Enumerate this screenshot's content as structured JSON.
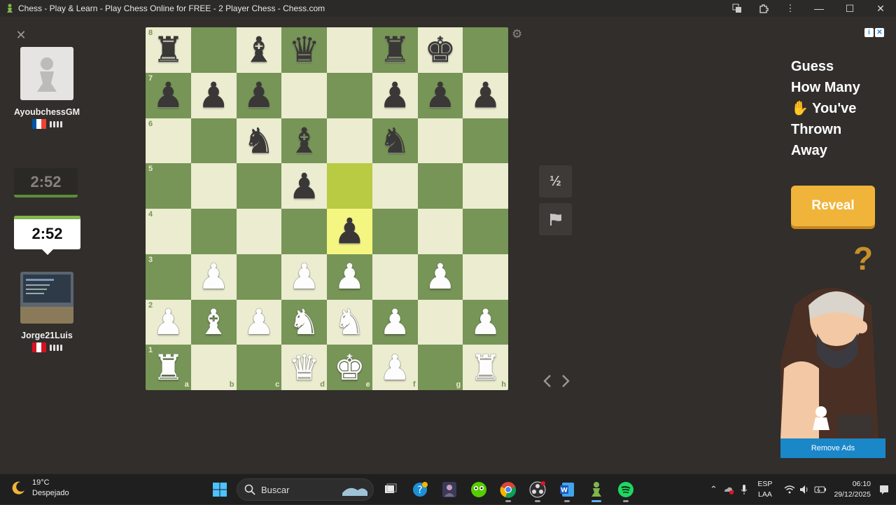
{
  "window": {
    "title": "Chess - Play & Learn - Play Chess Online for FREE - 2 Player Chess - Chess.com",
    "controls": {
      "minimize": "—",
      "maximize": "☐",
      "close": "✕"
    }
  },
  "players": {
    "opponent": {
      "name": "AyoubchessGM",
      "clock": "2:52",
      "country_colors": [
        "#0055a4",
        "#ffffff",
        "#ef4135"
      ]
    },
    "self": {
      "name": "Jorge21Luis",
      "clock": "2:52",
      "country_colors": [
        "#d91023",
        "#ffffff",
        "#d91023"
      ]
    }
  },
  "board": {
    "rank_labels": [
      "8",
      "7",
      "6",
      "5",
      "4",
      "3",
      "2",
      "1"
    ],
    "file_labels": [
      "a",
      "b",
      "c",
      "d",
      "e",
      "f",
      "g",
      "h"
    ],
    "highlighted_squares": [
      "e5",
      "e4"
    ],
    "position": [
      [
        "br",
        "",
        "bb",
        "bq",
        "",
        "br",
        "bk",
        ""
      ],
      [
        "bp",
        "bp",
        "bp",
        "",
        "",
        "bp",
        "bp",
        "bp"
      ],
      [
        "",
        "",
        "bn",
        "bb",
        "",
        "bn",
        "",
        ""
      ],
      [
        "",
        "",
        "",
        "bp",
        "",
        "",
        "",
        ""
      ],
      [
        "",
        "",
        "",
        "",
        "bp",
        "",
        "",
        ""
      ],
      [
        "",
        "wp",
        "",
        "wp",
        "wp",
        "",
        "wp",
        ""
      ],
      [
        "wp",
        "wb",
        "wp",
        "wn",
        "wn",
        "wp",
        "",
        "wp"
      ],
      [
        "wr",
        "",
        "",
        "wq",
        "wk",
        "wp",
        "",
        "wr"
      ]
    ],
    "piece_glyphs": {
      "k": "♚",
      "q": "♛",
      "r": "♜",
      "b": "♝",
      "n": "♞",
      "p": "♟"
    }
  },
  "controls": {
    "settings_icon": "gear-icon",
    "draw_label": "½",
    "resign_icon": "flag-icon",
    "prev_arrow": "‹",
    "next_arrow": "›"
  },
  "ad": {
    "headline_1": "Guess",
    "headline_2": "How Many",
    "headline_3": "You've",
    "headline_4": "Thrown",
    "headline_5": "Away",
    "button": "Reveal",
    "question_mark": "?",
    "remove_ads": "Remove Ads",
    "accent": "#f0b43b"
  },
  "taskbar": {
    "weather_temp": "19°C",
    "weather_desc": "Despejado",
    "search_label": "Buscar",
    "lang_1": "ESP",
    "lang_2": "LAA",
    "time": "06:10",
    "date": "29/12/2025"
  }
}
